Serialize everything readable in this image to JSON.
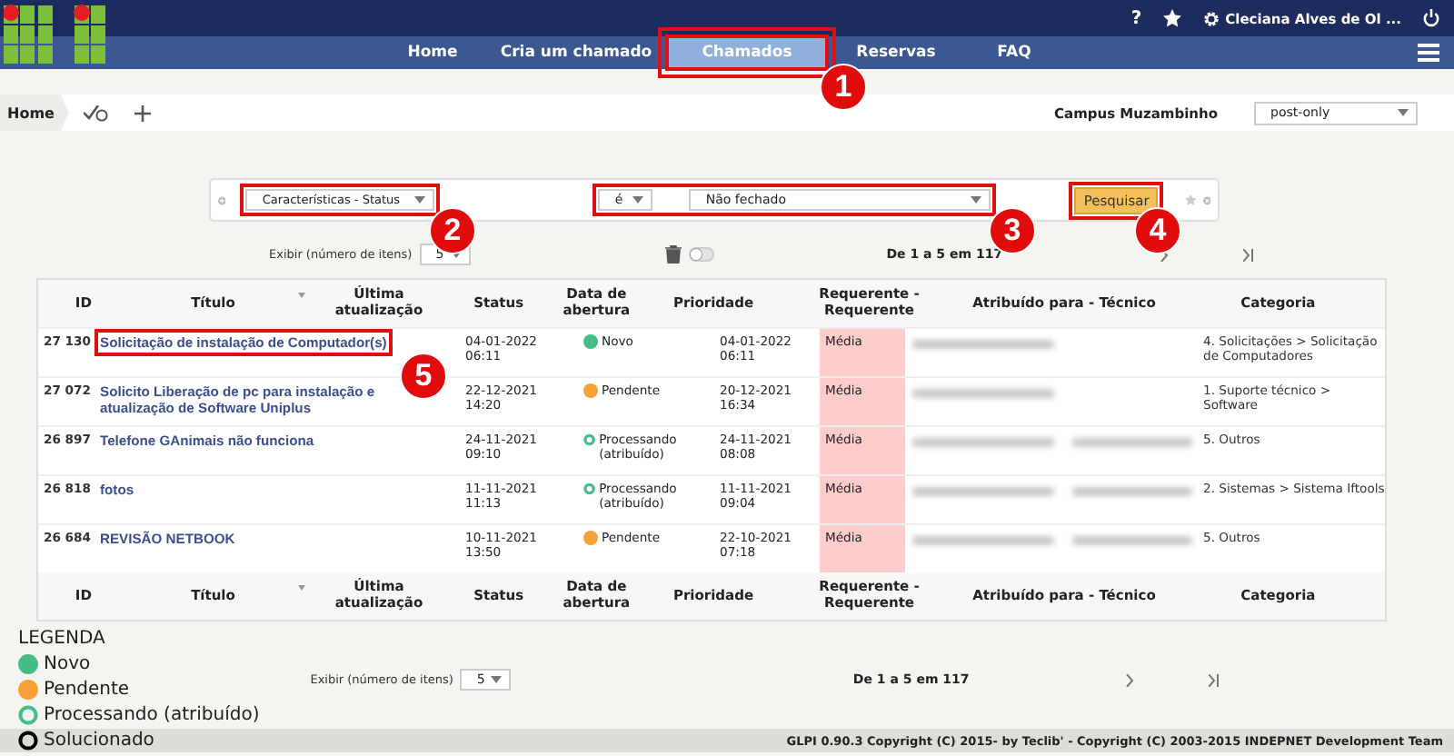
{
  "topbar": {
    "help": "?",
    "user": "Cleciana Alves de Ol ..."
  },
  "nav": [
    {
      "label": "Home",
      "selected": false,
      "highlighted": false
    },
    {
      "label": "Cria um chamado",
      "selected": false,
      "highlighted": false
    },
    {
      "label": "Chamados",
      "selected": true,
      "highlighted": true
    },
    {
      "label": "Reservas",
      "selected": false,
      "highlighted": false
    },
    {
      "label": "FAQ",
      "selected": false,
      "highlighted": false
    }
  ],
  "breadcrumb": {
    "home": "Home"
  },
  "entity": {
    "label": "Campus Muzambinho",
    "value": "post-only"
  },
  "search": {
    "field": {
      "value": "Características - Status",
      "highlighted": true
    },
    "operator": "é",
    "criterion": "Não fechado",
    "criteria_highlighted": true,
    "button": {
      "label": "Pesquisar",
      "highlighted": true
    }
  },
  "pagination_top": {
    "label": "Exibir (número de itens)",
    "per_page": "5",
    "toggle_on": false,
    "range": "De 1 a 5 em 117"
  },
  "table": {
    "columns": [
      {
        "label": "ID",
        "sorted": false
      },
      {
        "label": "Título",
        "sorted": false
      },
      {
        "label": "Última atualização",
        "sorted": true
      },
      {
        "label": "Status",
        "sorted": false
      },
      {
        "label": "Data de abertura",
        "sorted": false
      },
      {
        "label": "Prioridade",
        "sorted": false
      },
      {
        "label": "Requerente - Requerente",
        "sorted": false
      },
      {
        "label": "Atribuído para - Técnico",
        "sorted": false
      },
      {
        "label": "Categoria",
        "sorted": false
      }
    ],
    "rows": [
      {
        "id": "27 130",
        "title": "Solicitação de instalação de Computador(s)",
        "highlighted": true,
        "updated": "04-01-2022 06:11",
        "status": {
          "label": "Novo",
          "kind": "new"
        },
        "opened": "04-01-2022 06:11",
        "priority": "Média",
        "requester_redacted": true,
        "technician_redacted": false,
        "category": "4. Solicitações > Solicitação de Computadores"
      },
      {
        "id": "27 072",
        "title": "Solicito Liberação de pc para instalação e atualização de Software Uniplus",
        "highlighted": false,
        "updated": "22-12-2021 14:20",
        "status": {
          "label": "Pendente",
          "kind": "pending"
        },
        "opened": "20-12-2021 16:34",
        "priority": "Média",
        "requester_redacted": true,
        "technician_redacted": false,
        "category": "1. Suporte técnico > Software"
      },
      {
        "id": "26 897",
        "title": "Telefone GAnimais não funciona",
        "highlighted": false,
        "updated": "24-11-2021 09:10",
        "status": {
          "label": "Processando (atribuído)",
          "kind": "processing"
        },
        "opened": "24-11-2021 08:08",
        "priority": "Média",
        "requester_redacted": true,
        "technician_redacted": true,
        "category": "5. Outros"
      },
      {
        "id": "26 818",
        "title": "fotos",
        "highlighted": false,
        "updated": "11-11-2021 11:13",
        "status": {
          "label": "Processando (atribuído)",
          "kind": "processing"
        },
        "opened": "11-11-2021 09:04",
        "priority": "Média",
        "requester_redacted": true,
        "technician_redacted": true,
        "category": "2. Sistemas > Sistema Iftools"
      },
      {
        "id": "26 684",
        "title": "REVISÃO NETBOOK",
        "highlighted": false,
        "updated": "10-11-2021 13:50",
        "status": {
          "label": "Pendente",
          "kind": "pending"
        },
        "opened": "22-10-2021 07:18",
        "priority": "Média",
        "requester_redacted": true,
        "technician_redacted": true,
        "category": "5. Outros"
      }
    ],
    "footer_columns": [
      {
        "label": "ID",
        "sorted": false
      },
      {
        "label": "Título",
        "sorted": false
      },
      {
        "label": "Última atualização",
        "sorted": true
      },
      {
        "label": "Status",
        "sorted": false
      },
      {
        "label": "Data de abertura",
        "sorted": false
      },
      {
        "label": "Prioridade",
        "sorted": false
      },
      {
        "label": "Requerente - Requerente",
        "sorted": false
      },
      {
        "label": "Atribuído para - Técnico",
        "sorted": false
      },
      {
        "label": "Categoria",
        "sorted": false
      }
    ]
  },
  "legend": {
    "title": "LEGENDA",
    "items": [
      {
        "label": "Novo",
        "kind": "new"
      },
      {
        "label": "Pendente",
        "kind": "pending"
      },
      {
        "label": "Processando (atribuído)",
        "kind": "processing"
      },
      {
        "label": "Solucionado",
        "kind": "solved"
      }
    ]
  },
  "pagination_bottom": {
    "label": "Exibir (número de itens)",
    "per_page": "5",
    "range": "De 1 a 5 em 117"
  },
  "footer": "GLPI 0.90.3 Copyright (C) 2015- by Teclib' - Copyright (C) 2003-2015 INDEPNET Development Team",
  "callouts": [
    "1",
    "2",
    "3",
    "4",
    "5"
  ]
}
